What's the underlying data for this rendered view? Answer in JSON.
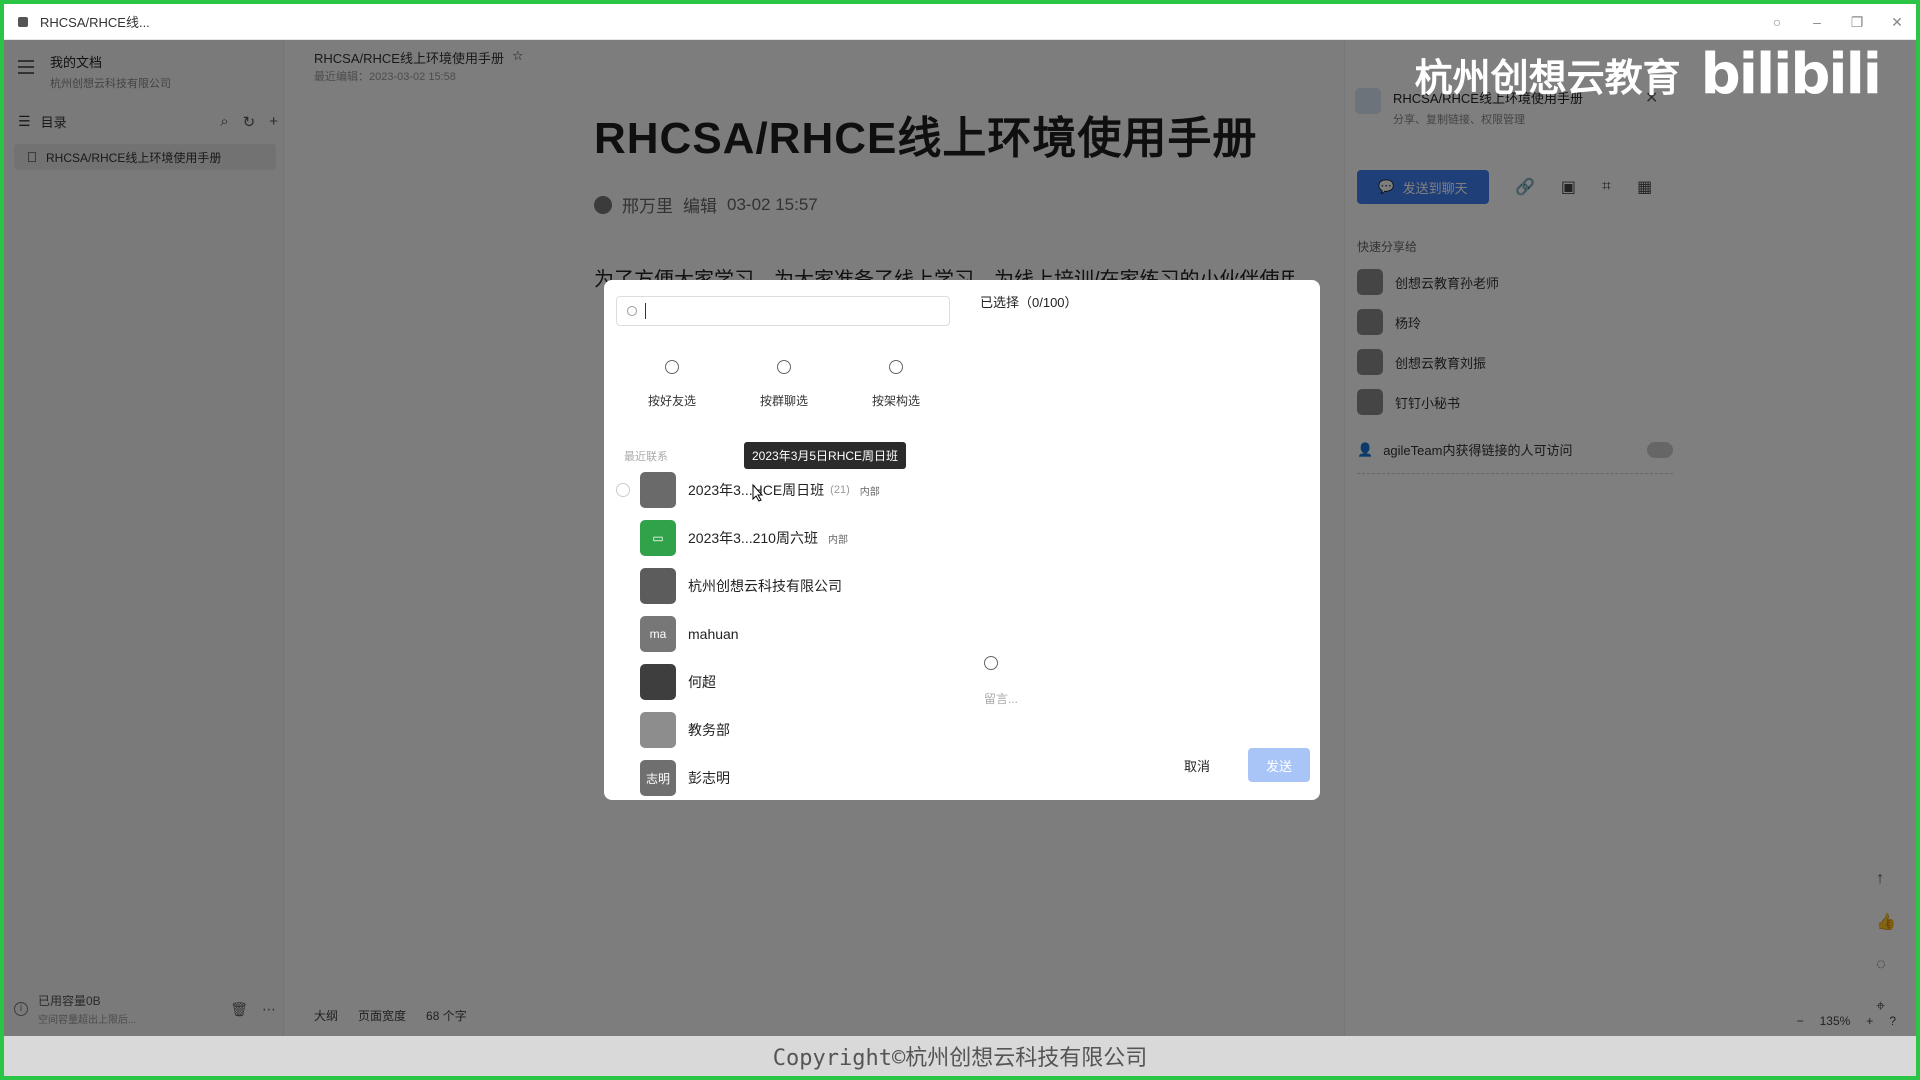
{
  "window": {
    "title": "RHCSA/RHCE线..."
  },
  "sidebar": {
    "title": "我的文档",
    "subtitle": "杭州创想云科技有限公司",
    "toc_label": "目录",
    "active_item": "RHCSA/RHCE线上环境使用手册",
    "footer_text": "已用容量0B",
    "footer_sub": "空间容量超出上限后..."
  },
  "doc": {
    "breadcrumb": "RHCSA/RHCE线上环境使用手册",
    "last_edit": "最近编辑：2023-03-02 15:58",
    "title": "RHCSA/RHCE线上环境使用手册",
    "author": "邢万里",
    "edit_label": "编辑",
    "edit_time": "03-02 15:57",
    "para": "为了方便大家学习，为大家准备了线上学习，为线上培训/在家练习的小伙伴使用",
    "outline": "大纲",
    "page_width": "页面宽度",
    "word_count": "68 个字"
  },
  "right_panel": {
    "card_title": "RHCSA/RHCE线上环境使用手册",
    "card_sub": "分享、复制链接、权限管理",
    "send_btn": "发送到聊天",
    "quick_share": "快速分享给",
    "contacts": [
      "创想云教育孙老师",
      "杨玲",
      "创想云教育刘振",
      "钉钉小秘书"
    ],
    "access_text": "agileTeam内获得链接的人可访问",
    "zoom": "135%"
  },
  "dialog": {
    "selected": "已选择（0/100）",
    "categories": [
      "按好友选",
      "按群聊选",
      "按架构选"
    ],
    "recent_label": "最近联系",
    "tooltip": "2023年3月5日RHCE周日班",
    "items": [
      {
        "name": "2023年3...HCE周日班",
        "count": "(21)",
        "tag": "内部"
      },
      {
        "name": "2023年3...210周六班",
        "count": "",
        "tag": "内部"
      },
      {
        "name": "杭州创想云科技有限公司",
        "count": "",
        "tag": ""
      },
      {
        "name": "mahuan",
        "count": "",
        "tag": "",
        "avatar_text": "ma"
      },
      {
        "name": "何超",
        "count": "",
        "tag": ""
      },
      {
        "name": "教务部",
        "count": "",
        "tag": ""
      },
      {
        "name": "彭志明",
        "count": "",
        "tag": "",
        "avatar_text": "志明"
      }
    ],
    "message_placeholder": "留言...",
    "cancel": "取消",
    "send": "发送"
  },
  "watermark": {
    "brand_cn": "杭州创想云教育",
    "brand_bili": "bilibili",
    "copyright": "Copyright©杭州创想云科技有限公司"
  },
  "colors": {
    "accent": "#3f7ef2",
    "border_green": "#2bc545"
  }
}
